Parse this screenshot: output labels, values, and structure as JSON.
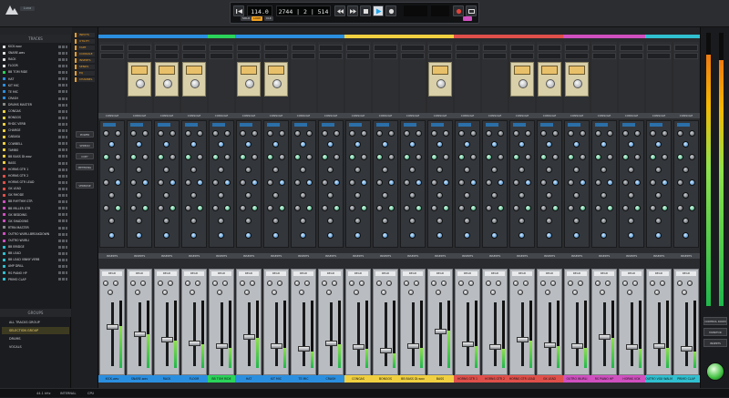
{
  "app": {
    "title": "Luna"
  },
  "transport": {
    "tempo": "114.0",
    "position": "2744 | 2 | 514",
    "sync_label": "SOLO",
    "mode_label": "LOOP",
    "click_label": "CLK",
    "play_state": "playing"
  },
  "tracks_panel": {
    "header": "TRACKS",
    "items": [
      {
        "name": "KICK.wav",
        "color": "#e0e0e0"
      },
      {
        "name": "SNARE.wav",
        "color": "#e0e0e0"
      },
      {
        "name": "RACK",
        "color": "#e0e0e0"
      },
      {
        "name": "FLOOR",
        "color": "#e0e0e0"
      },
      {
        "name": "BB TOM RIDE",
        "color": "#2bd35a"
      },
      {
        "name": "HAT",
        "color": "#2b8fe0"
      },
      {
        "name": "KIT MIC",
        "color": "#2b8fe0"
      },
      {
        "name": "TE MIC",
        "color": "#2b8fe0"
      },
      {
        "name": "CRASH",
        "color": "#2b8fe0"
      },
      {
        "name": "DRUMS MASTER",
        "color": "#8a8a8a"
      },
      {
        "name": "CONGAS",
        "color": "#f0d040"
      },
      {
        "name": "BONGOS",
        "color": "#f0d040"
      },
      {
        "name": "RHDC VERB",
        "color": "#f0d040"
      },
      {
        "name": "CHARGE",
        "color": "#f0d040"
      },
      {
        "name": "CABASA",
        "color": "#f0d040"
      },
      {
        "name": "COWBELL",
        "color": "#f0d040"
      },
      {
        "name": "TAMBO",
        "color": "#f0d040"
      },
      {
        "name": "BB BASS DI.wav",
        "color": "#f0d040"
      },
      {
        "name": "BASS",
        "color": "#f0d040"
      },
      {
        "name": "HORNS GTR 1",
        "color": "#e0504a"
      },
      {
        "name": "HORNS GTR 2",
        "color": "#e0504a"
      },
      {
        "name": "HORNS GTR LEAD",
        "color": "#e0504a"
      },
      {
        "name": "GK LEAD",
        "color": "#e0504a"
      },
      {
        "name": "GK RHODE",
        "color": "#e0504a"
      },
      {
        "name": "BB RHYTHM GTR",
        "color": "#d050c0"
      },
      {
        "name": "BB MILLER GTR",
        "color": "#d050c0"
      },
      {
        "name": "GK BEDDING",
        "color": "#d050c0"
      },
      {
        "name": "GK SHADOWS",
        "color": "#d050c0"
      },
      {
        "name": "RTRN MASTER",
        "color": "#8a8a8a"
      },
      {
        "name": "OUTRO WURLI-BREAKDOWN",
        "color": "#d050c0"
      },
      {
        "name": "OUTRO WURLI",
        "color": "#d050c0"
      },
      {
        "name": "BB BRIDGE",
        "color": "#30c0d0"
      },
      {
        "name": "BB LEAD",
        "color": "#30c0d0"
      },
      {
        "name": "BB LEAD VINNY VERB",
        "color": "#30c0d0"
      },
      {
        "name": "AMP DRILL",
        "color": "#30c0d0"
      },
      {
        "name": "RS PIANO HP",
        "color": "#30c0d0"
      },
      {
        "name": "PRIMO CLAP",
        "color": "#30c0d0"
      }
    ]
  },
  "groups_panel": {
    "header": "GROUPS",
    "items": [
      {
        "name": "ALL TRACKS GROUP",
        "selected": false
      },
      {
        "name": "SELECTION GROUP",
        "selected": true
      },
      {
        "name": "DRUMS",
        "selected": false
      },
      {
        "name": "VOCALS",
        "selected": false
      }
    ]
  },
  "view_panel": {
    "chips": [
      "INPUTS",
      "UTILITY",
      "TAPE",
      "CONSOLE",
      "INSERTS",
      "SENDS",
      "EQ",
      "CHANNEL"
    ],
    "buttons": [
      "POWER",
      "SPREAD",
      "COPY",
      "METERING",
      "VERBOSE"
    ]
  },
  "mixer": {
    "section_tape": "TAPE",
    "section_console": "CONSOLE",
    "section_inserts": "INSERTS",
    "read_label": "READ",
    "channels": [
      {
        "name": "KICK.wav",
        "color": "#2b8fe0",
        "plug": false,
        "level": 0.62
      },
      {
        "name": "SNARE.wav",
        "color": "#2b8fe0",
        "plug": true,
        "level": 0.5
      },
      {
        "name": "RACK",
        "color": "#2b8fe0",
        "plug": true,
        "level": 0.4
      },
      {
        "name": "FLOOR",
        "color": "#2b8fe0",
        "plug": true,
        "level": 0.35
      },
      {
        "name": "BB TOM RIDE",
        "color": "#2bd35a",
        "plug": false,
        "level": 0.3
      },
      {
        "name": "HAT",
        "color": "#2b8fe0",
        "plug": true,
        "level": 0.45
      },
      {
        "name": "KIT MIC",
        "color": "#2b8fe0",
        "plug": true,
        "level": 0.3
      },
      {
        "name": "TE MIC",
        "color": "#2b8fe0",
        "plug": false,
        "level": 0.25
      },
      {
        "name": "CRASH",
        "color": "#2b8fe0",
        "plug": false,
        "level": 0.35
      },
      {
        "name": "CONGAS",
        "color": "#f0d040",
        "plug": false,
        "level": 0.28
      },
      {
        "name": "BONGOS",
        "color": "#f0d040",
        "plug": false,
        "level": 0.22
      },
      {
        "name": "BB BASS DI.wav",
        "color": "#f0d040",
        "plug": false,
        "level": 0.3
      },
      {
        "name": "BASS",
        "color": "#f0d040",
        "plug": true,
        "level": 0.55
      },
      {
        "name": "HORNS GTR 1",
        "color": "#e0504a",
        "plug": false,
        "level": 0.33
      },
      {
        "name": "HORNS GTR 2",
        "color": "#e0504a",
        "plug": false,
        "level": 0.28
      },
      {
        "name": "HORNS GTR LEAD",
        "color": "#e0504a",
        "plug": true,
        "level": 0.4
      },
      {
        "name": "GK LEAD",
        "color": "#e0504a",
        "plug": true,
        "level": 0.32
      },
      {
        "name": "OUTRO WURLI",
        "color": "#d050c0",
        "plug": true,
        "level": 0.3
      },
      {
        "name": "RS PIANO HP",
        "color": "#d050c0",
        "plug": false,
        "level": 0.45
      },
      {
        "name": "HORNS VOX",
        "color": "#d050c0",
        "plug": false,
        "level": 0.28
      },
      {
        "name": "OUTRO VOX WALM",
        "color": "#30c0d0",
        "plug": false,
        "level": 0.3
      },
      {
        "name": "PRIMO CLAP",
        "color": "#30c0d0",
        "plug": false,
        "level": 0.25
      }
    ]
  },
  "master": {
    "level_left": 0.92,
    "level_right": 0.9,
    "buttons": [
      "CONTROL ROOM",
      "MONITOR",
      "INSERTS"
    ]
  },
  "status": {
    "sample_rate": "44.1 kHz",
    "clock": "INTERNAL",
    "cpu": "CPU"
  }
}
